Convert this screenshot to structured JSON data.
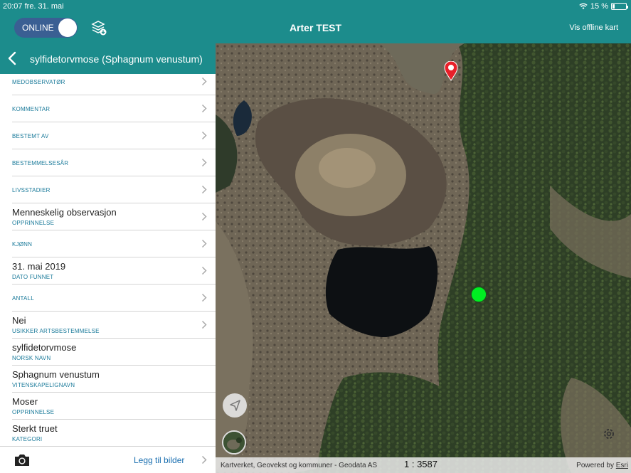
{
  "status": {
    "time": "20:07",
    "date": "fre. 31. mai",
    "battery": "15 %",
    "battery_level": 0.15
  },
  "appbar": {
    "online_label": "ONLINE",
    "title": "Arter TEST",
    "offline_link": "Vis offline kart"
  },
  "panel": {
    "title": "sylfidetorvmose (Sphagnum venustum)",
    "rows": [
      {
        "main": "",
        "sub": "MEDOBSERVATØR",
        "chevron": true
      },
      {
        "main": "",
        "sub": "KOMMENTAR",
        "chevron": true
      },
      {
        "main": "",
        "sub": "BESTEMT AV",
        "chevron": true
      },
      {
        "main": "",
        "sub": "BESTEMMELSESÅR",
        "chevron": true
      },
      {
        "main": "",
        "sub": "LIVSSTADIER",
        "chevron": true
      },
      {
        "main": "Menneskelig observasjon",
        "sub": "OPPRINNELSE",
        "chevron": true
      },
      {
        "main": "",
        "sub": "KJØNN",
        "chevron": true
      },
      {
        "main": "31. mai 2019",
        "sub": "DATO FUNNET",
        "chevron": true
      },
      {
        "main": "",
        "sub": "ANTALL",
        "chevron": true
      },
      {
        "main": "Nei",
        "sub": "USIKKER ARTSBESTEMMELSE",
        "chevron": true
      },
      {
        "main": "sylfidetorvmose",
        "sub": "NORSK NAVN",
        "chevron": false
      },
      {
        "main": "Sphagnum venustum",
        "sub": "VITENSKAPELIGNAVN",
        "chevron": false
      },
      {
        "main": "Moser",
        "sub": "OPPRINNELSE",
        "chevron": false
      },
      {
        "main": "Sterkt truet",
        "sub": "KATEGORI",
        "chevron": false
      }
    ],
    "footer": {
      "add_images": "Legg til bilder"
    }
  },
  "map": {
    "attribution": "Kartverket, Geovekst og kommuner - Geodata AS",
    "scale": "1 : 3587",
    "powered_by": "Powered by",
    "powered_by_brand": "Esri"
  },
  "colors": {
    "teal": "#1c8c8c",
    "toggle": "#3a5f93",
    "link": "#1a6fb0",
    "sublabel": "#1a7a9a",
    "marker_green": "#00ee22",
    "pin_red": "#e8202a"
  }
}
